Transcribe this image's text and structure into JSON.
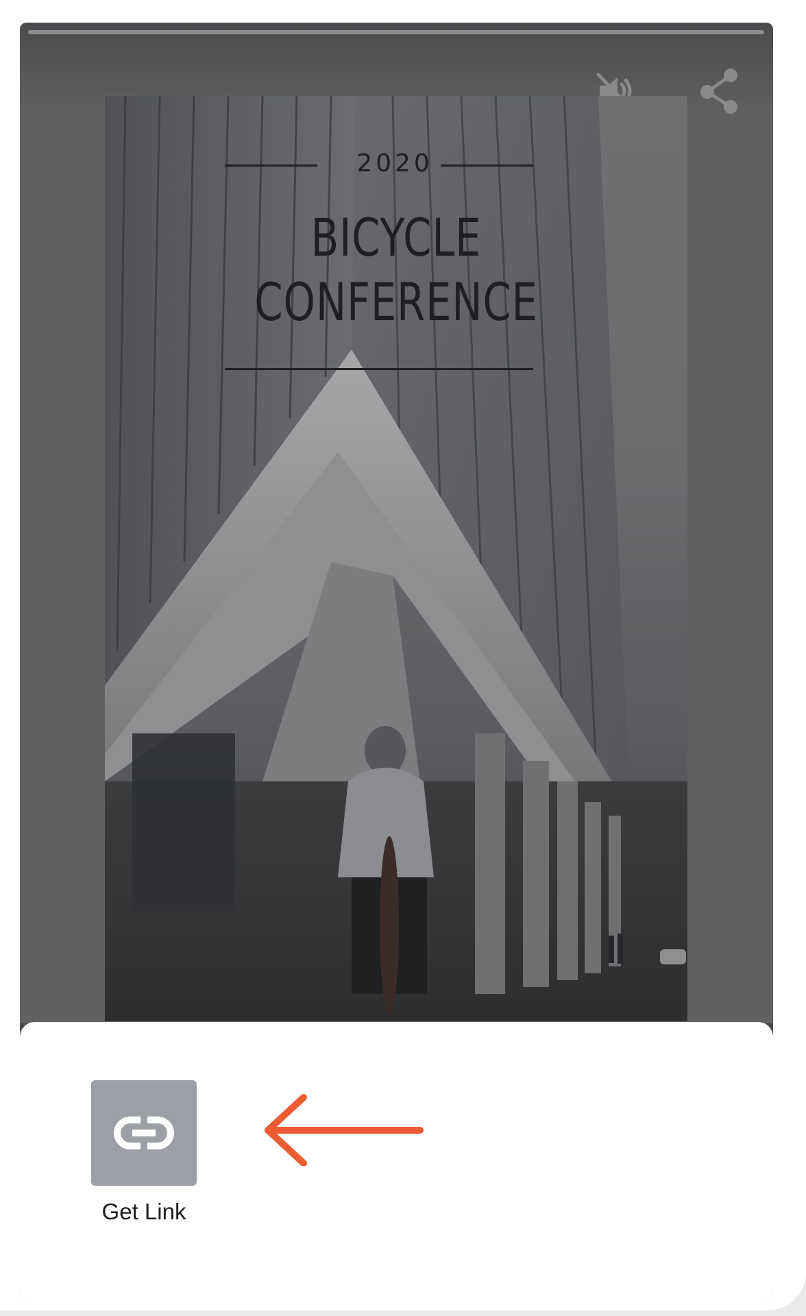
{
  "story": {
    "progress": 1.0,
    "mute_icon": "mute-icon",
    "share_icon": "share-icon"
  },
  "poster": {
    "year": "2020",
    "title_line1": "BICYCLE",
    "title_line2": "CONFERENCE"
  },
  "share_sheet": {
    "get_link_label": "Get Link",
    "get_link_icon": "link-icon",
    "annotation_arrow_color": "#ee5a32"
  },
  "colors": {
    "overlay": "#4a4a4d",
    "tile": "#9ca0a6",
    "accent_arrow": "#ee5a32"
  }
}
